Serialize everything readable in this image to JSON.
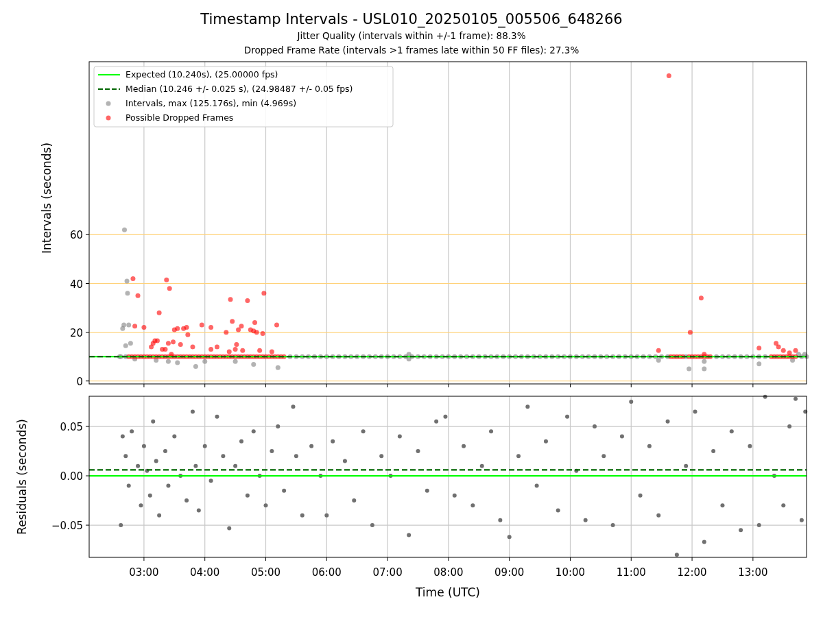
{
  "figure": {
    "title": "Timestamp Intervals - USL010_20250105_005506_648266",
    "subtitles": [
      "Jitter Quality (intervals within +/-1 frame): 88.3%",
      "Dropped Frame Rate (intervals >1 frames late within 50 FF files): 27.3%"
    ]
  },
  "intervals_plot": {
    "chart_data": {
      "type": "scatter",
      "ylabel": "Intervals (seconds)",
      "xlim": [
        2.1,
        13.88
      ],
      "ylim": [
        -1.2,
        131
      ],
      "grid": true,
      "yticks": [
        {
          "value": 0,
          "label": "0"
        },
        {
          "value": 20,
          "label": "20"
        },
        {
          "value": 40,
          "label": "40"
        },
        {
          "value": 60,
          "label": "60"
        }
      ],
      "legend": true,
      "ref_lines": [
        {
          "axis": "y",
          "value": 10,
          "label": "Expected (10.240s), (25.00000 fps)",
          "color": "#00ff00"
        },
        {
          "axis": "y",
          "value": 10,
          "label": "Median (10.246 +/- 0.025 s), (24.98487 +/- 0.05 fps)",
          "color": "#006400"
        }
      ],
      "series": [
        {
          "name": "Intervals, max (125.176s), min (4.969s)",
          "color": "#808080",
          "x": [
            2.6,
            2.7,
            5.4,
            5.5,
            5.6,
            5.7,
            5.8,
            5.9,
            6.0,
            6.1,
            6.2,
            6.3,
            6.4,
            6.5,
            6.6,
            6.7,
            6.8,
            6.9,
            7.0,
            7.1,
            7.2,
            7.3,
            7.4,
            7.5,
            7.6,
            7.7,
            7.8,
            7.9,
            8.0,
            8.1,
            8.2,
            8.3,
            8.4,
            8.5,
            8.6,
            8.7,
            8.8,
            8.9,
            9.0,
            9.1,
            9.2,
            9.3,
            9.4,
            9.5,
            9.6,
            9.7,
            9.8,
            9.9,
            10.0,
            10.1,
            10.2,
            10.3,
            10.4,
            10.5,
            10.6,
            10.7,
            10.8,
            10.9,
            11.0,
            11.1,
            11.2,
            11.3,
            11.4,
            11.5,
            11.6,
            11.9,
            12.4,
            12.5,
            12.6,
            12.7,
            12.8,
            12.9,
            13.0,
            13.1,
            13.2,
            13.8,
            13.88,
            2.62,
            2.65,
            2.67,
            2.68,
            2.7,
            2.72,
            2.73,
            2.75,
            2.78,
            2.85,
            3.2,
            3.4,
            3.55,
            3.85,
            4.0,
            4.5,
            4.8,
            5.2,
            7.35,
            7.35,
            11.45,
            11.95,
            12.2,
            12.2,
            13.1,
            13.65,
            13.75,
            13.85
          ],
          "values": [
            10,
            10,
            10,
            10,
            10,
            10,
            10,
            10,
            10,
            10,
            10,
            10,
            10,
            10,
            10,
            10,
            10,
            10,
            10,
            10,
            10,
            10,
            10,
            10,
            10,
            10,
            10,
            10,
            10,
            10,
            10,
            10,
            10,
            10,
            10,
            10,
            10,
            10,
            10,
            10,
            10,
            10,
            10,
            10,
            10,
            10,
            10,
            10,
            10,
            10,
            10,
            10,
            10,
            10,
            10,
            10,
            10,
            10,
            10,
            10,
            10,
            10,
            10,
            10,
            10,
            10,
            10,
            10,
            10,
            10,
            10,
            10,
            10,
            10,
            10,
            10,
            10,
            10,
            21.5,
            23,
            62,
            14.5,
            41,
            36,
            23,
            15.5,
            9,
            8.5,
            8,
            7.5,
            6,
            8,
            8,
            6.8,
            5.5,
            11,
            9,
            8.5,
            5,
            5,
            8,
            7,
            8.5,
            11,
            11
          ]
        },
        {
          "name": "Possible Dropped Frames",
          "color": "#ff0000",
          "x": [
            2.75,
            2.8,
            2.85,
            2.9,
            2.95,
            3.0,
            3.05,
            3.1,
            3.15,
            3.2,
            3.25,
            3.3,
            3.35,
            3.4,
            3.45,
            3.5,
            3.55,
            3.6,
            3.65,
            3.7,
            3.75,
            3.8,
            3.85,
            3.9,
            3.95,
            4.0,
            4.05,
            4.1,
            4.15,
            4.2,
            4.25,
            4.3,
            4.35,
            4.4,
            4.45,
            4.5,
            4.55,
            4.6,
            4.65,
            4.7,
            4.75,
            4.8,
            4.85,
            4.9,
            4.95,
            5.0,
            5.05,
            5.1,
            5.15,
            5.2,
            5.25,
            5.3,
            11.65,
            11.7,
            11.75,
            11.8,
            11.85,
            11.95,
            12.0,
            12.05,
            12.1,
            12.15,
            12.2,
            12.25,
            12.3,
            13.3,
            13.35,
            13.4,
            13.45,
            13.5,
            13.55,
            13.6,
            13.65,
            13.7,
            2.82,
            2.85,
            2.9,
            3.0,
            3.12,
            3.15,
            3.18,
            3.22,
            3.25,
            3.3,
            3.35,
            3.37,
            3.4,
            3.42,
            3.45,
            3.48,
            3.5,
            3.55,
            3.6,
            3.65,
            3.7,
            3.72,
            3.8,
            3.95,
            4.1,
            4.1,
            4.2,
            4.35,
            4.4,
            4.42,
            4.45,
            4.5,
            4.52,
            4.55,
            4.6,
            4.62,
            4.7,
            4.75,
            4.8,
            4.82,
            4.85,
            4.9,
            4.95,
            4.97,
            5.1,
            5.18,
            11.45,
            11.62,
            11.97,
            12.15,
            12.2,
            13.1,
            13.38,
            13.42,
            13.5,
            13.6,
            13.7
          ],
          "values": [
            10,
            10,
            10,
            10,
            10,
            10,
            10,
            10,
            10,
            10,
            10,
            10,
            10,
            10,
            10,
            10,
            10,
            10,
            10,
            10,
            10,
            10,
            10,
            10,
            10,
            10,
            10,
            10,
            10,
            10,
            10,
            10,
            10,
            10,
            10,
            10,
            10,
            10,
            10,
            10,
            10,
            10,
            10,
            10,
            10,
            10,
            10,
            10,
            10,
            10,
            10,
            10,
            10,
            10,
            10,
            10,
            10,
            10,
            10,
            10,
            10,
            10,
            10,
            10,
            10,
            10,
            10,
            10,
            10,
            10,
            10,
            10,
            10,
            10,
            42,
            22.5,
            35,
            22,
            14,
            15.5,
            16.5,
            16.5,
            28,
            13,
            13,
            41.5,
            15.5,
            38,
            11,
            16,
            21,
            21.5,
            15,
            21.5,
            22,
            19,
            14,
            23,
            22,
            13,
            14,
            20,
            12,
            33.5,
            24.5,
            13,
            15,
            21,
            22.5,
            12.5,
            33,
            21,
            20.5,
            24,
            20,
            12.5,
            19.5,
            36,
            12,
            23,
            12.5,
            125.2,
            20,
            34,
            11,
            13.5,
            15.5,
            14,
            12.5,
            11.5,
            12.5
          ]
        }
      ]
    }
  },
  "residuals_plot": {
    "chart_data": {
      "type": "scatter",
      "xlabel": "Time (UTC)",
      "ylabel": "Residuals (seconds)",
      "xlim": [
        2.1,
        13.88
      ],
      "ylim": [
        -0.0826,
        0.0806
      ],
      "grid": true,
      "xticks": [
        {
          "value": 3,
          "label": "03:00"
        },
        {
          "value": 4,
          "label": "04:00"
        },
        {
          "value": 5,
          "label": "05:00"
        },
        {
          "value": 6,
          "label": "06:00"
        },
        {
          "value": 7,
          "label": "07:00"
        },
        {
          "value": 8,
          "label": "08:00"
        },
        {
          "value": 9,
          "label": "09:00"
        },
        {
          "value": 10,
          "label": "10:00"
        },
        {
          "value": 11,
          "label": "11:00"
        },
        {
          "value": 12,
          "label": "12:00"
        },
        {
          "value": 13,
          "label": "13:00"
        }
      ],
      "yticks": [
        {
          "value": -0.05,
          "label": "−0.05"
        },
        {
          "value": 0,
          "label": "0.00"
        },
        {
          "value": 0.05,
          "label": "0.05"
        }
      ],
      "ref_lines": [
        {
          "axis": "y",
          "value": 0,
          "color": "#00ff00"
        },
        {
          "axis": "y",
          "value": 0.006,
          "color": "#006400"
        }
      ],
      "series": [
        {
          "color": "#707070",
          "x": [
            2.62,
            2.65,
            2.7,
            2.75,
            2.8,
            2.9,
            2.95,
            3.0,
            3.05,
            3.1,
            3.15,
            3.2,
            3.25,
            3.35,
            3.4,
            3.5,
            3.6,
            3.7,
            3.8,
            3.85,
            3.9,
            4.0,
            4.1,
            4.2,
            4.3,
            4.4,
            4.5,
            4.6,
            4.7,
            4.8,
            4.9,
            5.0,
            5.1,
            5.2,
            5.3,
            5.45,
            5.5,
            5.6,
            5.75,
            5.9,
            6.0,
            6.1,
            6.3,
            6.45,
            6.6,
            6.75,
            6.9,
            7.05,
            7.2,
            7.35,
            7.5,
            7.65,
            7.8,
            7.95,
            8.1,
            8.25,
            8.4,
            8.55,
            8.7,
            8.85,
            9.0,
            9.15,
            9.3,
            9.45,
            9.6,
            9.8,
            9.95,
            10.1,
            10.25,
            10.4,
            10.55,
            10.7,
            10.85,
            11.0,
            11.15,
            11.3,
            11.45,
            11.6,
            11.75,
            11.9,
            12.05,
            12.2,
            12.35,
            12.5,
            12.65,
            12.8,
            12.95,
            13.1,
            13.2,
            13.35,
            13.5,
            13.6,
            13.7,
            13.8,
            13.86
          ],
          "values": [
            -0.05,
            0.04,
            0.02,
            -0.01,
            0.045,
            0.01,
            -0.03,
            0.03,
            0.005,
            -0.02,
            0.055,
            0.015,
            -0.04,
            0.025,
            -0.01,
            0.04,
            0.0,
            -0.025,
            0.065,
            0.01,
            -0.035,
            0.03,
            -0.005,
            0.06,
            0.02,
            -0.053,
            0.01,
            0.035,
            -0.02,
            0.045,
            0.0,
            -0.03,
            0.025,
            0.05,
            -0.015,
            0.07,
            0.02,
            -0.04,
            0.03,
            0.0,
            -0.04,
            0.035,
            0.015,
            -0.025,
            0.045,
            -0.05,
            0.02,
            0.0,
            0.04,
            -0.06,
            0.025,
            -0.015,
            0.055,
            0.06,
            -0.02,
            0.03,
            -0.03,
            0.01,
            0.045,
            -0.045,
            -0.062,
            0.02,
            0.07,
            -0.01,
            0.035,
            -0.035,
            0.06,
            0.005,
            -0.045,
            0.05,
            0.02,
            -0.05,
            0.04,
            0.075,
            -0.02,
            0.03,
            -0.04,
            0.055,
            -0.08,
            0.01,
            0.065,
            -0.067,
            0.025,
            -0.03,
            0.045,
            -0.055,
            0.03,
            -0.05,
            0.08,
            0.0,
            -0.03,
            0.05,
            0.078,
            -0.045,
            0.065
          ]
        }
      ]
    }
  }
}
